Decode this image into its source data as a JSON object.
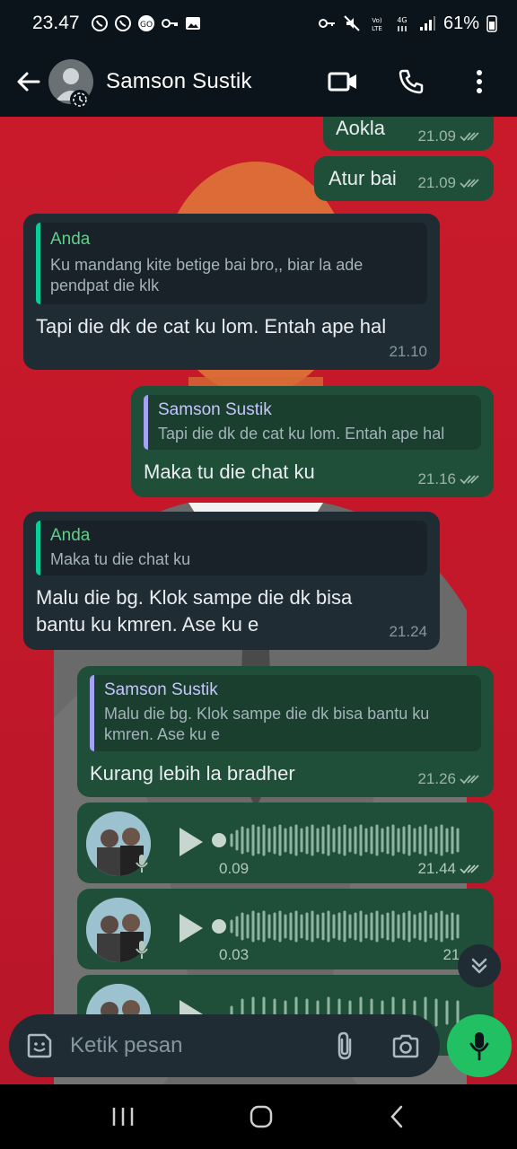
{
  "status_bar": {
    "time": "23.47",
    "battery": "61%",
    "network": "4G"
  },
  "header": {
    "contact_name": "Samson Sustik"
  },
  "messages": [
    {
      "text": "Aokla",
      "time": "21.09"
    },
    {
      "text": "Atur bai",
      "time": "21.09"
    },
    {
      "quote_author": "Anda",
      "quote_text": "Ku mandang kite betige bai bro,, biar la ade pendpat die klk",
      "text": "Tapi die dk de cat ku lom. Entah ape hal",
      "time": "21.10"
    },
    {
      "quote_author": "Samson Sustik",
      "quote_text": "Tapi die dk de cat ku lom. Entah ape hal",
      "text": "Maka tu die chat ku",
      "time": "21.16"
    },
    {
      "quote_author": "Anda",
      "quote_text": "Maka tu die chat ku",
      "text": "Malu die bg. Klok sampe die dk bisa bantu ku kmren. Ase ku e",
      "time": "21.24"
    },
    {
      "quote_author": "Samson Sustik",
      "quote_text": "Malu die bg. Klok sampe die dk bisa bantu ku kmren. Ase ku e",
      "text": "Kurang lebih la bradher",
      "time": "21.26"
    }
  ],
  "voice_notes": [
    {
      "duration": "0.09",
      "time": "21.44"
    },
    {
      "duration": "0.03",
      "time": "21.44"
    }
  ],
  "composer": {
    "placeholder": "Ketik pesan"
  },
  "colors": {
    "outgoing_bubble": "#1f4f38",
    "incoming_bubble": "#1f2c34",
    "accent": "#21c063",
    "wallpaper": "#c81a2a"
  }
}
